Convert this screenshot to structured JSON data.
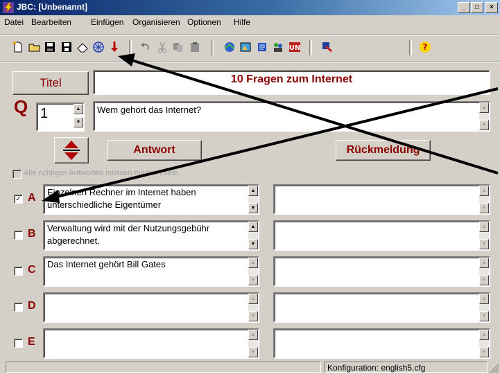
{
  "window": {
    "title": "JBC: [Unbenannt]",
    "controls": [
      "_",
      "□",
      "×"
    ]
  },
  "menu": {
    "datei": "Datei",
    "bearbeiten": "Bearbeiten",
    "einfuegen": "Einfügen",
    "organisieren": "Organisieren",
    "optionen": "Optionen",
    "hilfe": "Hilfe"
  },
  "toolbar": {
    "new": "new-file-icon",
    "open": "open-folder-icon",
    "save": "save-icon",
    "save_as": "save-as-icon",
    "erase": "eraser-icon",
    "web": "web-icon",
    "down": "red-arrow-icon",
    "undo": "undo-icon",
    "cut": "cut-icon",
    "copy": "copy-icon",
    "paste": "paste-icon",
    "export1": "export-web-icon",
    "export2": "export-image-icon",
    "export3": "export-scroll-icon",
    "export4": "export-people-icon",
    "export5": "export-un-icon",
    "config": "config-icon",
    "help": "?"
  },
  "editor": {
    "titel_button": "Titel",
    "title_value": "10 Fragen zum Internet",
    "q_label": "Q",
    "question_number": "1",
    "question_text": "Wem gehört das Internet?",
    "antwort_button": "Antwort",
    "rueckmeldung_button": "Rückmeldung",
    "all_correct_label": "Alle richtigen Antworten müssen markiert sein",
    "answers": [
      {
        "letter": "A",
        "checked": true,
        "check_mark": "✓",
        "text_line1": "Einzelnen Rechner im Internet haben",
        "text_line2": "unterschiedliche Eigentümer",
        "feedback": ""
      },
      {
        "letter": "B",
        "checked": false,
        "check_mark": "",
        "text_line1": "Verwaltung wird mit der Nutzungsgebühr",
        "text_line2": "abgerechnet.",
        "feedback": ""
      },
      {
        "letter": "C",
        "checked": false,
        "check_mark": "",
        "text_line1": "Das Internet gehört Bill Gates",
        "text_line2": "",
        "feedback": ""
      },
      {
        "letter": "D",
        "checked": false,
        "check_mark": "",
        "text_line1": "",
        "text_line2": "",
        "feedback": ""
      },
      {
        "letter": "E",
        "checked": false,
        "check_mark": "",
        "text_line1": "",
        "text_line2": "",
        "feedback": ""
      }
    ]
  },
  "status": {
    "config": "Konfiguration: english5.cfg"
  },
  "colors": {
    "accent": "#8b0000",
    "titlebar_start": "#0a246a",
    "titlebar_end": "#a6caf0",
    "face": "#d4d0c8"
  }
}
